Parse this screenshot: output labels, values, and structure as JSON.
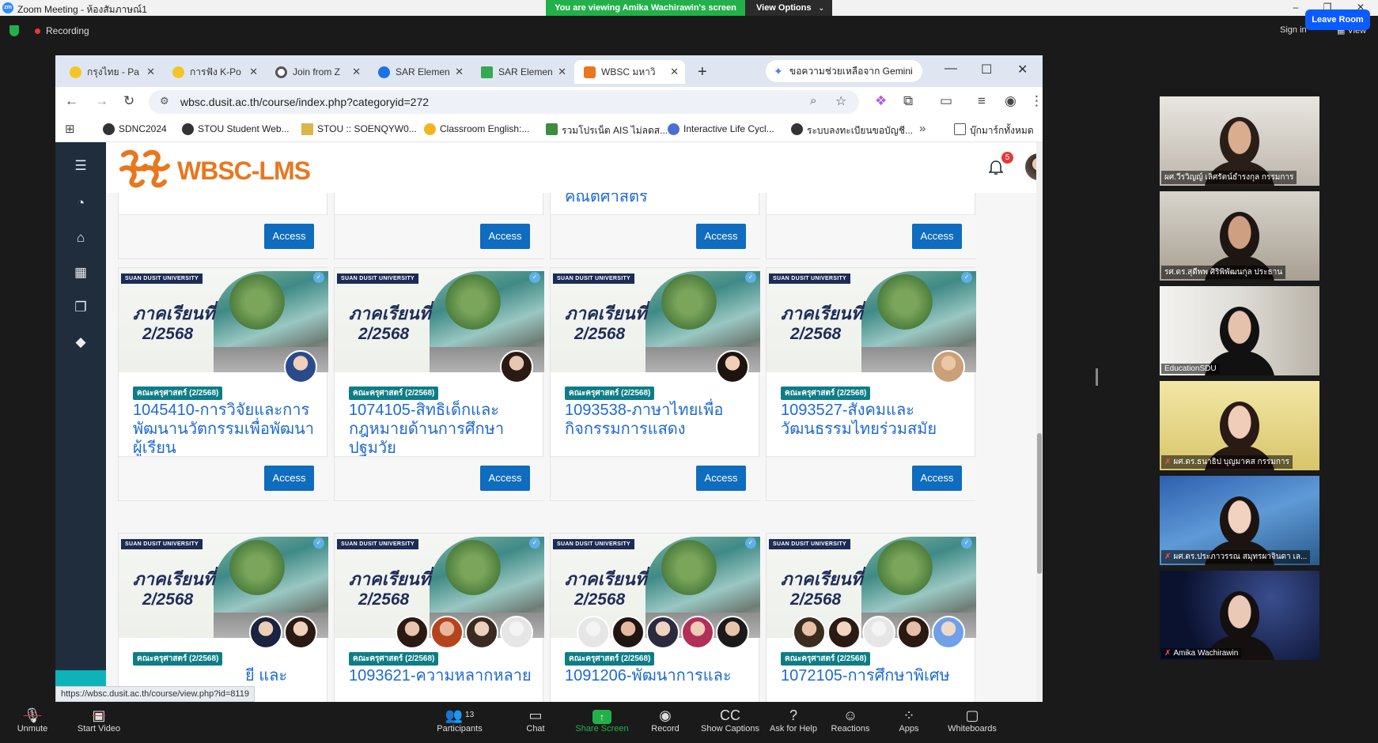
{
  "zoom": {
    "window_title": "Zoom Meeting - ห้องสัมภาษณ์1",
    "app_logo": "zm",
    "viewing_banner": "You are viewing Amika Wachirawin's screen",
    "view_options": "View Options",
    "recording_label": "Recording",
    "sign_in": "Sign in",
    "view": "View",
    "window_controls": {
      "minimize": "–",
      "restore": "❐",
      "close": "✕"
    },
    "toolbar": [
      {
        "label": "Unmute",
        "icon": "mic-muted-icon"
      },
      {
        "label": "Start Video",
        "icon": "video-off-icon"
      },
      {
        "label": "Participants",
        "icon": "participants-icon",
        "count": "13"
      },
      {
        "label": "Chat",
        "icon": "chat-icon"
      },
      {
        "label": "Share Screen",
        "icon": "share-screen-icon"
      },
      {
        "label": "Record",
        "icon": "record-icon"
      },
      {
        "label": "Show Captions",
        "icon": "captions-icon"
      },
      {
        "label": "Ask for Help",
        "icon": "help-icon"
      },
      {
        "label": "Reactions",
        "icon": "reactions-icon"
      },
      {
        "label": "Apps",
        "icon": "apps-icon"
      },
      {
        "label": "Whiteboards",
        "icon": "whiteboards-icon"
      }
    ],
    "leave_room": "Leave Room",
    "participants": [
      {
        "name": "ผศ.วีรวิญญ์ เลิศรัตน์ธำรงกุล  กรรมการ",
        "muted": false
      },
      {
        "name": "รศ.ดร.สุดีพพ ศิริพิพัฒนกุล  ประธาน",
        "muted": false
      },
      {
        "name": "EducationSDU",
        "muted": false
      },
      {
        "name": "ผศ.ดร.ธนาธิป บุญมาคส  กรรมการ",
        "muted": true
      },
      {
        "name": "ผศ.ดร.ประภาวรรณ สมุทรผาจินดา  เล...",
        "muted": true
      },
      {
        "name": "Amika Wachirawin",
        "muted": true
      }
    ]
  },
  "browser": {
    "tabs": [
      {
        "label": "กรุงไทย - Pa",
        "icon_color": "#f3c623"
      },
      {
        "label": "การฟัง K-Po",
        "icon_color": "#f3c623"
      },
      {
        "label": "Join from Z",
        "icon_color": "#555555"
      },
      {
        "label": "SAR Elemen",
        "icon_color": "#1a73e8"
      },
      {
        "label": "SAR Elemen",
        "icon_color": "#34a853"
      },
      {
        "label": "WBSC มหาวิ",
        "icon_color": "#e8771e",
        "active": true
      }
    ],
    "new_tab": "+",
    "gemini": "ขอความช่วยเหลือจาก Gemini",
    "url": "wbsc.dusit.ac.th/course/index.php?categoryid=272",
    "bookmarks": [
      {
        "label": "SDNC2024",
        "icon_color": "#333333"
      },
      {
        "label": "STOU Student Web...",
        "icon_color": "#333333"
      },
      {
        "label": "STOU :: SOENQYW0...",
        "icon_color": "#d9b64a"
      },
      {
        "label": "Classroom English:...",
        "icon_color": "#f2b51d"
      },
      {
        "label": "รวมโปรเน็ต AIS ไม่ลดส...",
        "icon_color": "#3d8c40"
      },
      {
        "label": "Interactive Life Cycl...",
        "icon_color": "#4b6fd1"
      },
      {
        "label": "ระบบลงทะเบียนขอบัญชี...",
        "icon_color": "#333333"
      }
    ],
    "bookmarks_more": "»",
    "all_bookmarks": "บุ๊กมาร์กทั้งหมด",
    "status_url": "https://wbsc.dusit.ac.th/course/view.php?id=8119"
  },
  "lms": {
    "logo_text": "WBSC-LMS",
    "notification_count": "5",
    "partial_title": "คณิตศาสตร",
    "access_label": "Access",
    "ribbon": "SUAN DUSIT UNIVERSITY",
    "semester_line1": "ภาคเรียนที่",
    "semester_line2": "2/2568",
    "category": "คณะครุศาสตร์ (2/2568)",
    "courses_row2": [
      {
        "title": "1045410-การวิจัยและการพัฒนานวัตกรรมเพื่อพัฒนาผู้เรียน"
      },
      {
        "title": "1074105-สิทธิเด็กและกฎหมายด้านการศึกษาปฐมวัย"
      },
      {
        "title": "1093538-ภาษาไทยเพื่อกิจกรรมการแสดง"
      },
      {
        "title": "1093527-สังคมและวัฒนธรรมไทยร่วมสมัย"
      }
    ],
    "courses_row3": [
      {
        "title": "ยี และ"
      },
      {
        "title": "1093621-ความหลากหลาย"
      },
      {
        "title": "1091206-พัฒนาการและ"
      },
      {
        "title": "1072105-การศึกษาพิเศษ"
      }
    ]
  }
}
